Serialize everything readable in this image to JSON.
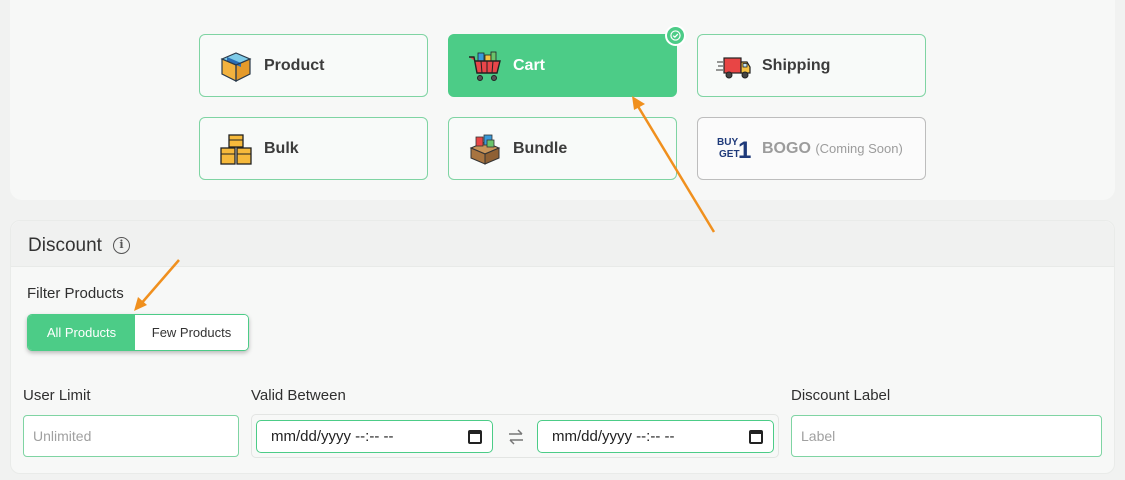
{
  "types": [
    {
      "id": "product",
      "label": "Product",
      "icon": "product-box-icon"
    },
    {
      "id": "cart",
      "label": "Cart",
      "icon": "shopping-cart-icon",
      "active": true
    },
    {
      "id": "shipping",
      "label": "Shipping",
      "icon": "delivery-truck-icon"
    },
    {
      "id": "bulk",
      "label": "Bulk",
      "icon": "stacked-boxes-icon"
    },
    {
      "id": "bundle",
      "label": "Bundle",
      "icon": "gift-bundle-icon"
    },
    {
      "id": "bogo",
      "label": "BOGO",
      "sublabel": "(Coming Soon)",
      "icon": "buy-get-icon",
      "disabled": true
    }
  ],
  "bogo_logo": {
    "line1": "BUY",
    "line2": "GET",
    "digit": "1"
  },
  "discount": {
    "title": "Discount",
    "filter_label": "Filter Products",
    "filter_options": [
      "All Products",
      "Few Products"
    ],
    "filter_selected": "All Products",
    "user_limit_label": "User Limit",
    "user_limit_placeholder": "Unlimited",
    "valid_between_label": "Valid Between",
    "date_start_placeholder": "mm/dd/yyyy --:-- --",
    "date_end_placeholder": "mm/dd/yyyy --:-- --",
    "discount_label_label": "Discount Label",
    "discount_label_placeholder": "Label"
  },
  "colors": {
    "accent": "#4ccc87",
    "annotation_arrow": "#f0901e"
  }
}
